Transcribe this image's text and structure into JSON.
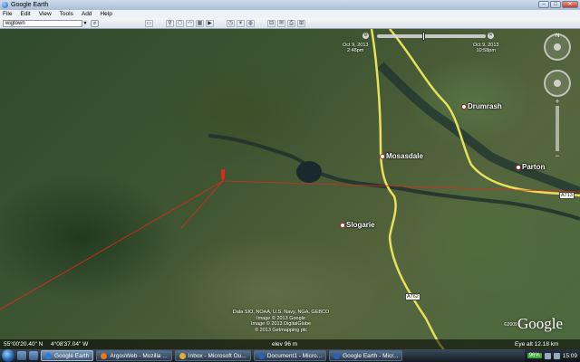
{
  "window": {
    "title": "Google Earth"
  },
  "menu": [
    "File",
    "Edit",
    "View",
    "Tools",
    "Add",
    "Help"
  ],
  "search": {
    "value": "wigtown"
  },
  "places": [
    {
      "name": "Mosasdale"
    },
    {
      "name": "Drumrash"
    },
    {
      "name": "Parton"
    },
    {
      "name": "Slogarie"
    }
  ],
  "roads": {
    "a713": "A713",
    "a762": "A762"
  },
  "timeslider": {
    "start_date": "Oct 9, 2013",
    "start_time": "2:48pm",
    "end_date": "Oct 9, 2013",
    "end_time": "10:58pm"
  },
  "navigation": {
    "north": "N",
    "zoom_in": "+",
    "zoom_out": "−"
  },
  "credits": [
    "Data SIO, NOAA, U.S. Navy, NGA, GEBCO",
    "Image © 2013 Google",
    "Image © 2013 DigitalGlobe",
    "© 2013 Getmapping plc"
  ],
  "logo": {
    "text": "Google",
    "year": "©2009"
  },
  "status": {
    "coordinates_lat": "55°00'20.40\" N",
    "coordinates_lon": "4°08'37.04\" W",
    "elevation": "elev   96 m",
    "eye_alt": "Eye alt   12.18 km"
  },
  "taskbar": {
    "tasks": [
      "Google Earth",
      "ArgosWeb - Mozilla ...",
      "Inbox - Microsoft Ou...",
      "Document1 - Micro...",
      "Google Earth - Micr..."
    ],
    "battery": "96%",
    "time": "15:09"
  },
  "colors": {
    "road": "#e6e05a",
    "track": "#e0281e",
    "accent": "#1a5fb4"
  }
}
